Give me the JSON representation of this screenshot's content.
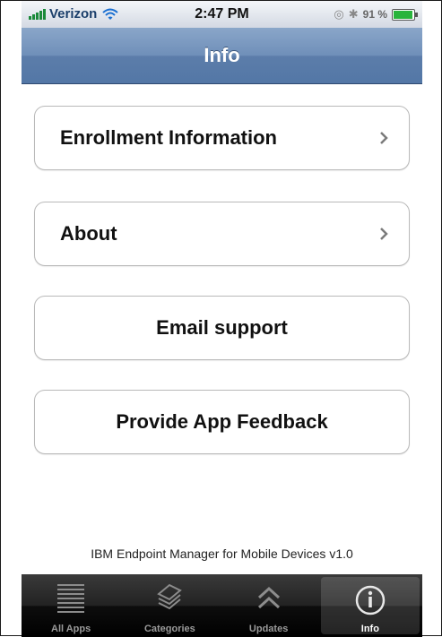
{
  "status_bar": {
    "carrier": "Verizon",
    "time": "2:47 PM",
    "battery_percent": "91 %"
  },
  "nav": {
    "title": "Info"
  },
  "menu": {
    "items": [
      {
        "label": "Enrollment Information",
        "has_chevron": true
      },
      {
        "label": "About",
        "has_chevron": true
      },
      {
        "label": "Email support",
        "has_chevron": false
      },
      {
        "label": "Provide App Feedback",
        "has_chevron": false
      }
    ]
  },
  "footer": {
    "text": "IBM Endpoint Manager for Mobile Devices v1.0"
  },
  "tab_bar": {
    "tabs": [
      {
        "label": "All Apps",
        "icon": "list-icon"
      },
      {
        "label": "Categories",
        "icon": "stack-icon"
      },
      {
        "label": "Updates",
        "icon": "double-chevron-up-icon"
      },
      {
        "label": "Info",
        "icon": "info-icon",
        "selected": true
      }
    ]
  },
  "colors": {
    "nav_bar": "#6f8fb9",
    "battery_fill": "#29b43c",
    "signal": "#1b8a3a"
  }
}
